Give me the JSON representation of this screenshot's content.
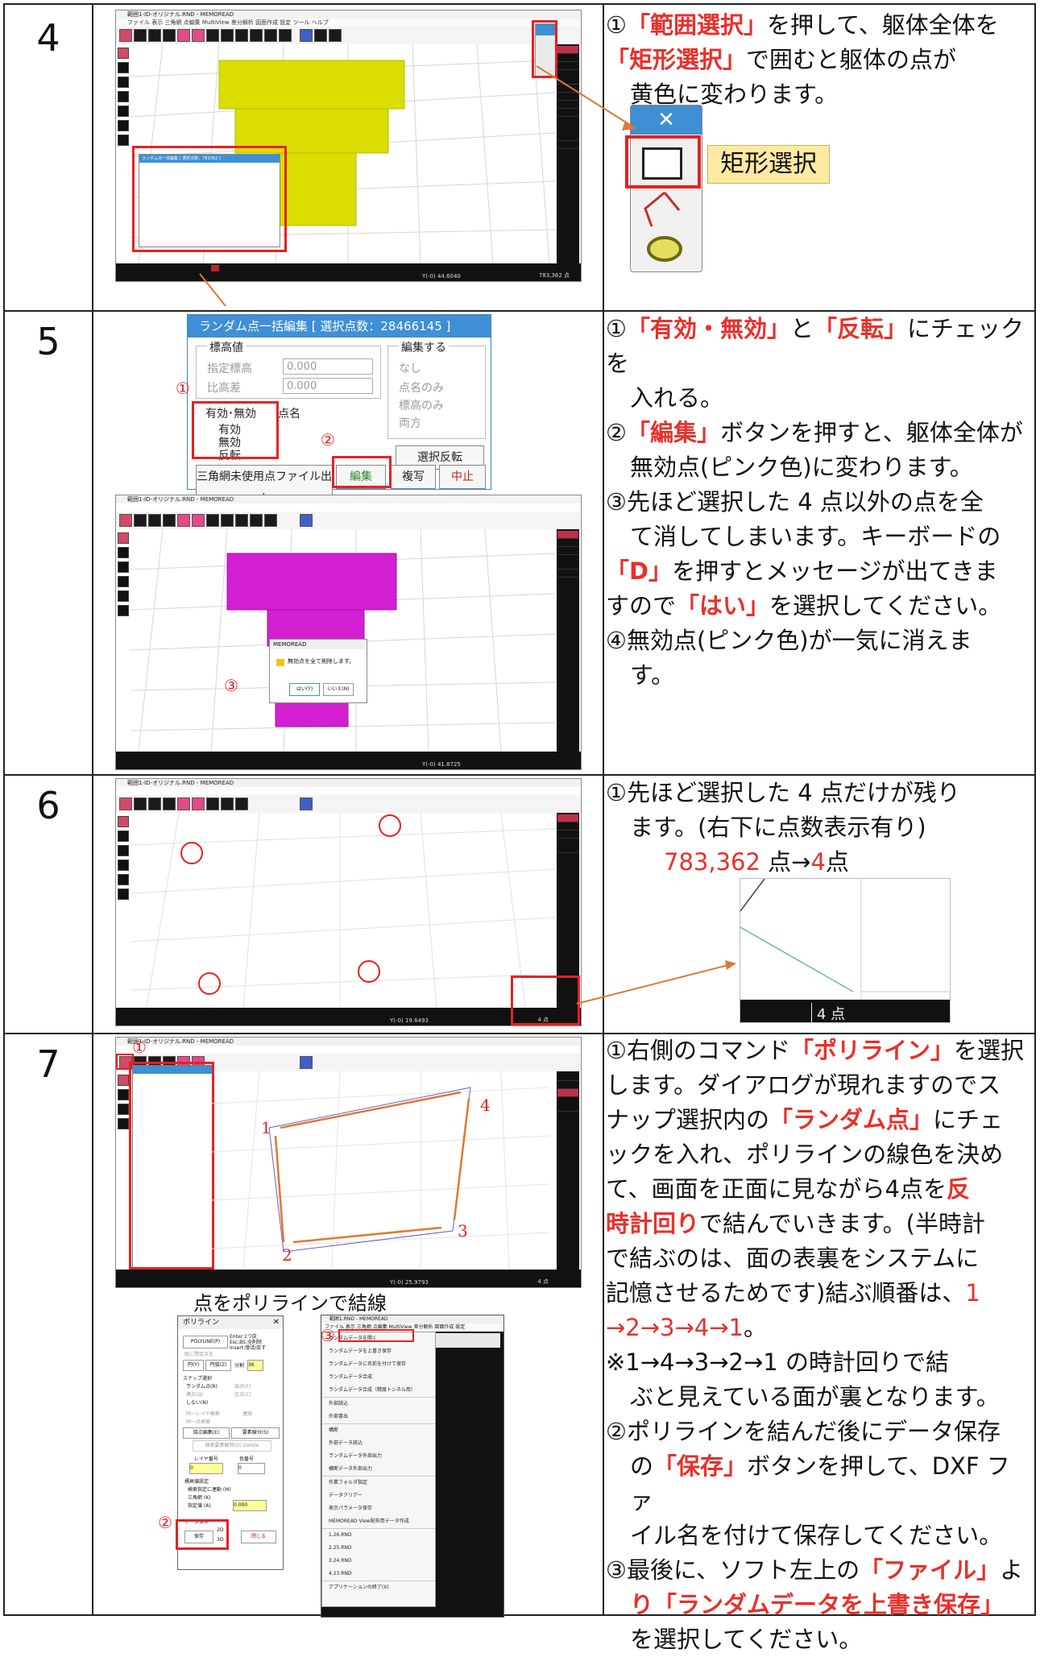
{
  "rows": [
    {
      "num": "4"
    },
    {
      "num": "5"
    },
    {
      "num": "6"
    },
    {
      "num": "7"
    }
  ],
  "row4": {
    "window_title": "範囲1-ID-オリジナル.RND - MEMOREAD",
    "menu": "ファイル  表示  三角網  点編集  MultiView  差分解析  図面作成  設定  ツール  ヘルプ",
    "small_dialog_title": "ランダム点一括編集 [ 選択点数：783362 ]",
    "status_coords": "Y(-0) 44.6040",
    "status_points": "783,362 点",
    "callout_label": "矩形選択",
    "text": [
      {
        "pre": "①",
        "hl1": "「範囲選択」",
        "post1": "を押して、躯体全体を"
      },
      {
        "hl2": "「矩形選択」",
        "post2": "で囲むと躯体の点が"
      },
      {
        "line3": "黄色に変わります。"
      }
    ]
  },
  "row5": {
    "dialog": {
      "title": "ランダム点一括編集 [ 選択点数：28466145 ]",
      "group_z": "標高値",
      "opt_specified": "指定標高",
      "opt_ratio": "比高差",
      "val1": "0.000",
      "val2": "0.000",
      "group_edit": "編集する",
      "opt_none": "なし",
      "opt_name_only": "点名のみ",
      "opt_z_only": "標高のみ",
      "opt_both": "両方",
      "chk_valid": "有効･無効",
      "chk_name": "点名",
      "r_valid": "有効",
      "r_invalid": "無効",
      "r_reverse": "反転",
      "btn_select_reverse": "選択反転",
      "btn_output": "三角網未使用点ファイル出力",
      "btn_edit": "編集",
      "btn_copy": "複写",
      "btn_cancel": "中止"
    },
    "mark1": "①",
    "mark2": "②",
    "mark3": "③",
    "window_title": "範囲1-ID-オリジナル.RND - MEMOREAD",
    "msg_title": "MEMOREAD",
    "msg_text": "無効点を全て削除します。",
    "msg_yes": "はい(Y)",
    "msg_no": "いいえ(N)",
    "status_coords": "Y(-0) 41.8725",
    "text": {
      "l1_pre": "①",
      "l1_hl1": "「有効・無効」",
      "l1_mid": "と",
      "l1_hl2": "「反転」",
      "l1_post": "にチェックを",
      "l2": "入れる。",
      "l3_pre": "②",
      "l3_hl": "「編集」",
      "l3_post": "ボタンを押すと、躯体全体が",
      "l4": "無効点(ピンク色)に変わります。",
      "l5": "③先ほど選択した 4 点以外の点を全",
      "l6": "て消してしまいます。キーボードの",
      "l7_hl": "「D」",
      "l7_post": "を押すとメッセージが出てきま",
      "l8_pre": "すので",
      "l8_hl": "「はい」",
      "l8_post": "を選択してください。",
      "l9": "④無効点(ピンク色)が一気に消えま",
      "l10": "す。"
    }
  },
  "row6": {
    "window_title": "範囲1-ID-オリジナル.RND - MEMOREAD",
    "status_coords": "Y(-0) 19.6493",
    "status_points": "4 点",
    "zoom_label": "4 点",
    "text": {
      "l1": "①先ほど選択した 4 点だけが残り",
      "l2": "ます。(右下に点数表示有り)",
      "count_before": "783,362",
      "mid": " 点→",
      "count_after": "4",
      "end": "点"
    }
  },
  "row7": {
    "window_title": "範囲1-ID-オリジナル.RND - MEMOREAD",
    "poly_dialog": {
      "title": "ポリライン",
      "polyline_btn": "POLYLINE(P)",
      "hint1": "Enter:1つ戻",
      "hint2": "Esc,BS:全削除",
      "hint3": "Insert:復活/戻す",
      "chk_close": "既に閉合点を",
      "btn_circle": "円(Y)",
      "btn_arc": "円弧(Z)",
      "div_label": "分割",
      "div_val": "36",
      "snap_group": "スナップ選択",
      "snap_random": "ランダム点(R)",
      "snap_end": "端点(F)",
      "snap_vertex": "構点(Q)",
      "snap_center": "交点(C)",
      "snap_none": "しない(N)",
      "chk_layer_search": "同一レイヤ検索",
      "chk_link": "連続",
      "chk_same_search": "同一点検索",
      "btn_node_edit": "接点編集(E)",
      "btn_point_sel": "要素線分(S)",
      "btn_search": "検索要素解除(D) Delete",
      "layer_label": "レイヤ番号",
      "color_label": "色番号",
      "layer_val": "0",
      "color_val": "0",
      "z_group": "標高値設定",
      "z_opt1": "検索指定に連動 (M)",
      "z_opt2": "三角網 (K)",
      "z_opt3": "指定値 (A)",
      "z_val": "0.000",
      "save_group": "データ保存",
      "save_btn": "保存",
      "opt_2d": "2D",
      "opt_3d": "3D",
      "close_btn": "閉じる"
    },
    "caption": "点をポリラインで結線",
    "menu_title": "範囲1.RND - MEMOREAD",
    "menu_bar": "ファイル  表示  三角網  点編集  MultiView  差分解析  図面作成  設定",
    "menu_items": [
      "ランダムデータを開く",
      "ランダムデータを上書き保存",
      "ランダムデータに名前を付けて保存",
      "ランダムデータ合成",
      "ランダムデータ合成（精度トンネル用）",
      "外部読込",
      "外部書出",
      "構断",
      "外部データ読込",
      "ランダムデータ外部出力",
      "横断データ外部出力",
      "作業フォルダ指定",
      "データクリアー",
      "表示パラメータ保存",
      "MEMOREAD View配布用データ作成",
      "1.26.RND",
      "2.25.RND",
      "3.24.RND",
      "4.23.RND",
      "アプリケーションの終了(X)"
    ],
    "pt_labels": [
      "1",
      "2",
      "3",
      "4"
    ],
    "status_coords": "Y(-0) 25.9793",
    "status_points": "4 点",
    "text": {
      "l1_pre": "①右側のコマンド",
      "l1_hl": "「ポリライン」",
      "l1_post": "を選択",
      "l2": "します。ダイアログが現れますのでス",
      "l3_pre": "ナップ選択内の",
      "l3_hl": "「ランダム点」",
      "l3_post": "にチェ",
      "l4": "ックを入れ、ポリラインの線色を決め",
      "l5_pre": "て、画面を正面に見ながら4点を",
      "l5_hl": "反",
      "l6_hl": "時計回り",
      "l6_post": "で結んでいきます。(半時計",
      "l7": "で結ぶのは、面の表裏をシステムに",
      "l8_pre": "記憶させるためです)結ぶ順番は、",
      "l8_hl": "1",
      "l9_hl": "→2→3→4→1",
      "l9_post": "。",
      "l10": "※1→4→3→2→1 の時計回りで結",
      "l11": "ぶと見えている面が裏となります。",
      "l12": "②ポリラインを結んだ後にデータ保存",
      "l13_pre": "の",
      "l13_hl": "「保存」",
      "l13_post": "ボタンを押して、DXF ファ",
      "l14": "イル名を付けて保存してください。",
      "l15_pre": "③最後に、ソフト左上の",
      "l15_hl": "「ファイル」",
      "l15_post": "よ",
      "l16_hl": "り「ランダムデータを上書き保存」",
      "l17": "を選択してください。"
    }
  },
  "colors": {
    "accent_red": "#e8302b",
    "yellow_model": "#d9dd00",
    "magenta_model": "#d21fd2",
    "arrow_orange": "#e07830",
    "dialog_blue": "#3e8fd4",
    "callout_bg": "#fde9a2"
  }
}
